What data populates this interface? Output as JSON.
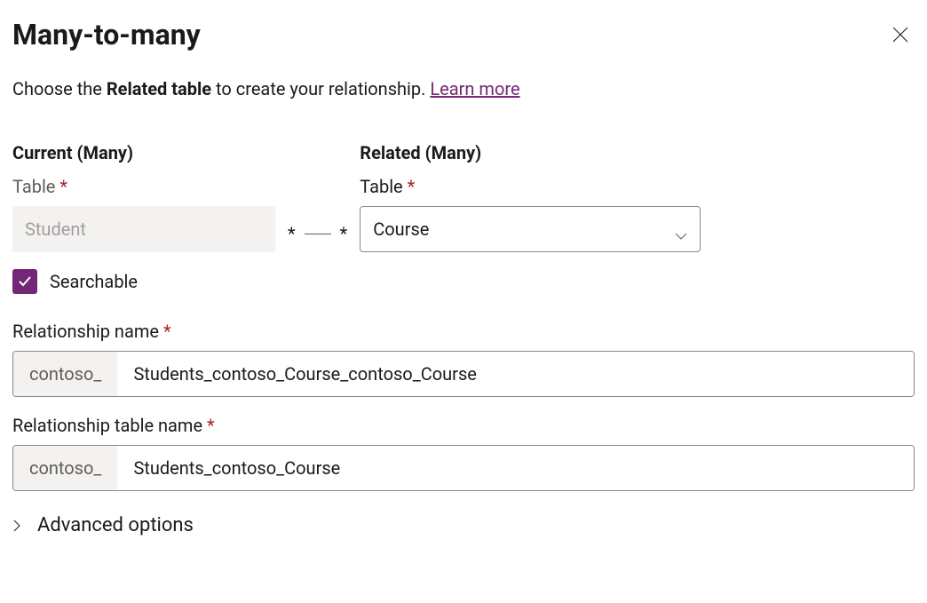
{
  "header": {
    "title": "Many-to-many"
  },
  "intro": {
    "prefix": "Choose the ",
    "bold": "Related table",
    "suffix": " to create your relationship. ",
    "link": "Learn more"
  },
  "current": {
    "heading": "Current (Many)",
    "table_label": "Table",
    "table_value": "Student"
  },
  "connector": {
    "left": "*",
    "right": "*"
  },
  "related": {
    "heading": "Related (Many)",
    "table_label": "Table",
    "table_value": "Course"
  },
  "searchable": {
    "label": "Searchable",
    "checked": true
  },
  "relationship_name": {
    "label": "Relationship name",
    "prefix": "contoso_",
    "value": "Students_contoso_Course_contoso_Course"
  },
  "relationship_table_name": {
    "label": "Relationship table name",
    "prefix": "contoso_",
    "value": "Students_contoso_Course"
  },
  "advanced": {
    "label": "Advanced options"
  }
}
